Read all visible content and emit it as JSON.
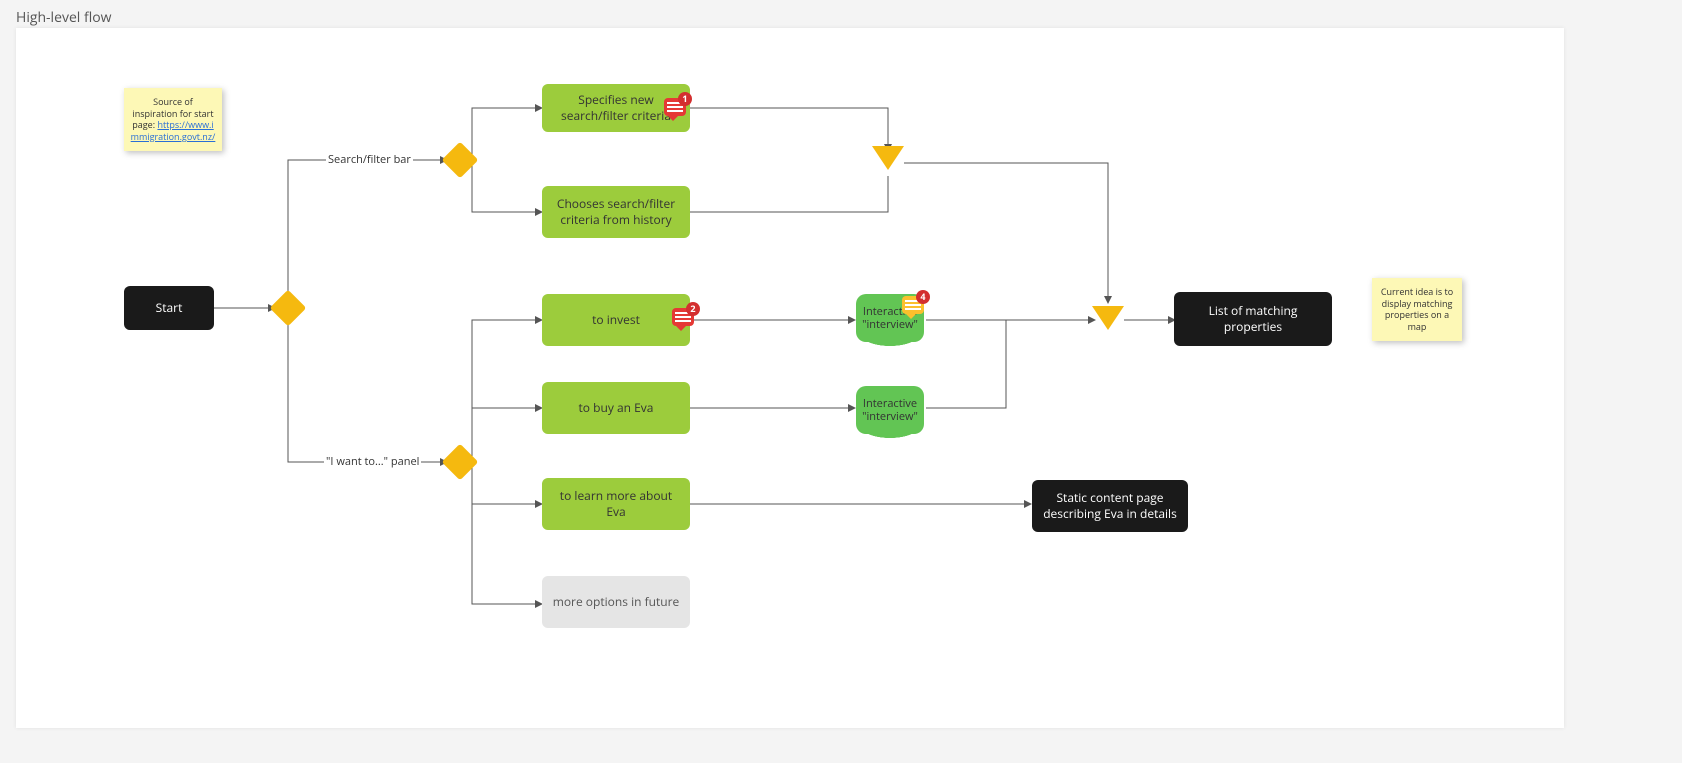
{
  "title": "High-level flow",
  "sticky1": {
    "prefix": "Source of inspiration for start page: ",
    "link": "https://www.immigration.govt.nz/"
  },
  "sticky2": "Current idea is to display matching properties on a map",
  "labels": {
    "searchbar": "Search/filter bar",
    "iwantto": "\"I want to...\" panel"
  },
  "nodes": {
    "start": "Start",
    "specNew": "Specifies new search/filter criteria",
    "fromHistory": "Chooses search/filter criteria from history",
    "invest": "to invest",
    "buyEva": "to buy an Eva",
    "learn": "to learn more about Eva",
    "future": "more options in future",
    "interview1": "Interactive \"interview\"",
    "interview2": "Interactive \"interview\"",
    "list": "List of matching properties",
    "static": "Static content page describing Eva in details"
  },
  "badges": {
    "c1": "1",
    "c2": "2",
    "c4": "4"
  }
}
